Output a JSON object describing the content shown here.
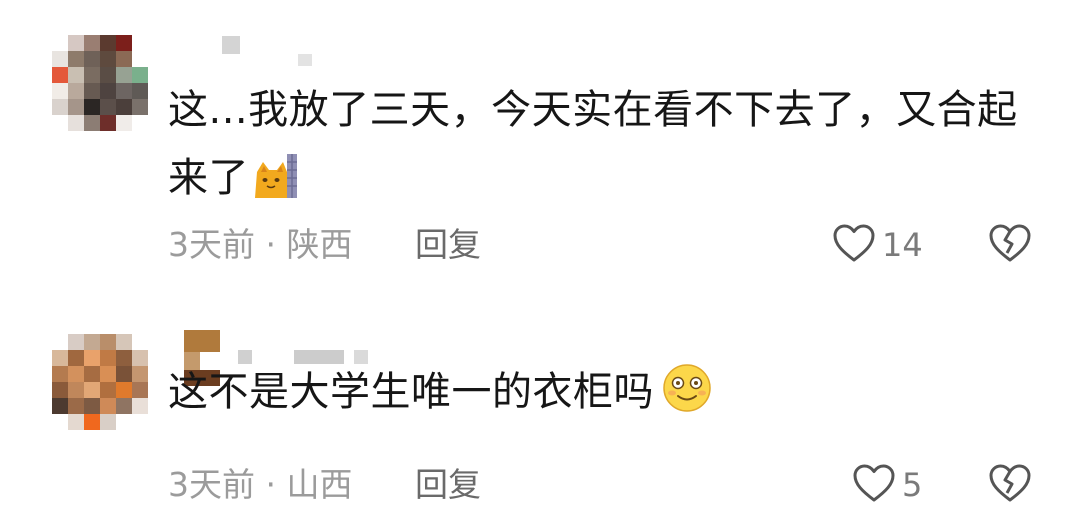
{
  "comments": [
    {
      "text": "这...我放了三天，今天实在看不下去了，又合起来了",
      "emoji": "cat-emoji",
      "time_location": "3天前 · 陕西",
      "reply_label": "回复",
      "like_count": "14"
    },
    {
      "text": "这不是大学生唯一的衣柜吗",
      "emoji": "smile-emoji",
      "time_location": "3天前 · 山西",
      "reply_label": "回复",
      "like_count": "5"
    }
  ],
  "colors": {
    "text": "#161616",
    "meta": "#9b9b9b",
    "reply": "#6a6a6a",
    "icon": "#555555"
  }
}
